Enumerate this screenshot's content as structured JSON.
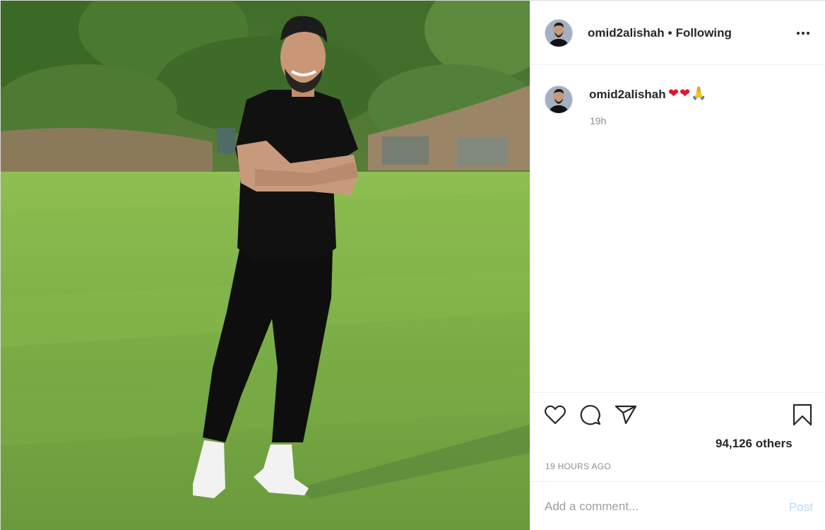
{
  "post": {
    "photo_alt": "",
    "header": {
      "username": "omid2alishah",
      "separator": "•",
      "follow_status": "Following",
      "more_icon": "more-options-icon"
    },
    "caption": {
      "username": "omid2alishah",
      "emoji_heart_1": "❤",
      "emoji_heart_2": "❤",
      "emoji_pray": "🙏",
      "time": "19h"
    },
    "actions": {
      "like_icon": "heart-icon",
      "comment_icon": "comment-bubble-icon",
      "share_icon": "paper-plane-icon",
      "save_icon": "bookmark-icon"
    },
    "likes": "94,126 others",
    "timestamp": "19 HOURS AGO",
    "comment_input": {
      "placeholder": "Add a comment...",
      "value": ""
    },
    "post_button_label": "Post"
  },
  "colors": {
    "text": "#262626",
    "muted": "#8e8e8e",
    "border": "#efefef",
    "post_button_disabled": "#b3dbff",
    "heart_emoji": "#e0172b"
  }
}
